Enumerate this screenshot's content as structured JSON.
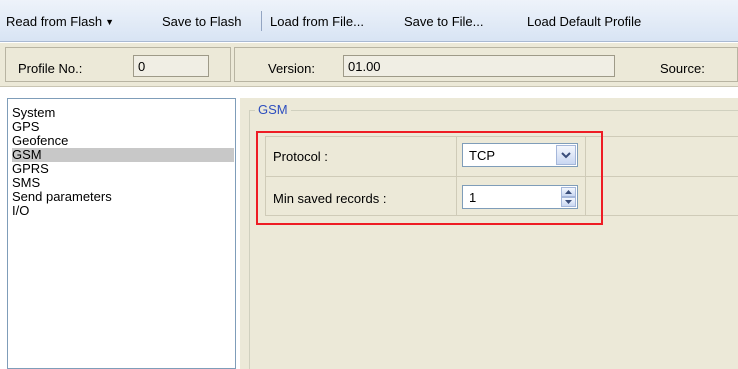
{
  "toolbar": {
    "read_flash": "Read from Flash",
    "save_flash": "Save to Flash",
    "load_file": "Load from File...",
    "save_file": "Save to File...",
    "load_default": "Load Default Profile"
  },
  "profile_bar": {
    "profile_label": "Profile No.:",
    "profile_value": "0",
    "version_label": "Version:",
    "version_value": "01.00",
    "source_label": "Source:"
  },
  "tree": {
    "items": [
      {
        "label": "System"
      },
      {
        "label": "GPS"
      },
      {
        "label": "Geofence"
      },
      {
        "label": "GSM"
      },
      {
        "label": "GPRS"
      },
      {
        "label": "SMS"
      },
      {
        "label": "Send parameters"
      },
      {
        "label": "I/O"
      }
    ],
    "selected": "GSM"
  },
  "group": {
    "title": "GSM"
  },
  "settings": {
    "protocol_label": "Protocol :",
    "protocol_value": "TCP",
    "min_records_label": "Min saved records :",
    "min_records_value": "1"
  },
  "colors": {
    "highlight": "#ee1c24",
    "group_title": "#2e4fbf",
    "selected_item": "#c8c8c8"
  }
}
